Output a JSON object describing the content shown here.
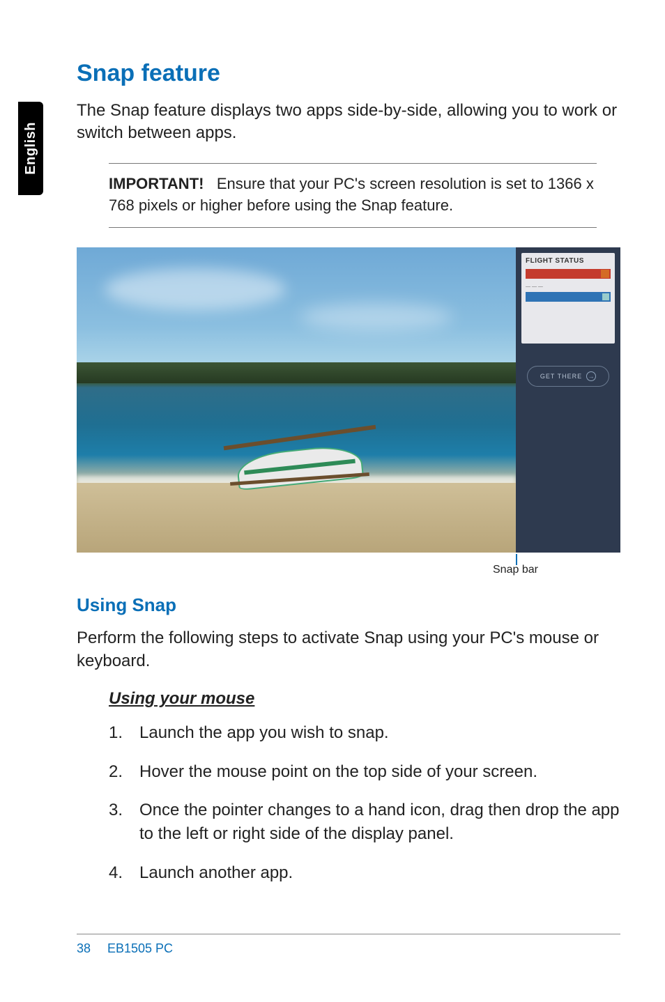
{
  "side_tab": "English",
  "section_title": "Snap feature",
  "lead": "The Snap feature displays two apps side-by-side, allowing you to work or switch between apps.",
  "important_label": "IMPORTANT!",
  "important_text": "Ensure that your PC's screen resolution is set to 1366 x 768 pixels or higher before using the Snap feature.",
  "figure": {
    "right_panel": {
      "title": "FLIGHT STATUS",
      "button": "GET THERE"
    }
  },
  "snap_bar_caption": "Snap bar",
  "using_snap_title": "Using Snap",
  "using_snap_body": "Perform the following steps to activate Snap using your PC's mouse or keyboard.",
  "mouse_heading": "Using your mouse",
  "steps": [
    "Launch the app you wish to snap.",
    "Hover the mouse point on the top side of your screen.",
    "Once the pointer changes to a hand icon, drag then drop the app to the left or right side of the display panel.",
    "Launch another app."
  ],
  "footer": {
    "page": "38",
    "doc": "EB1505 PC"
  }
}
